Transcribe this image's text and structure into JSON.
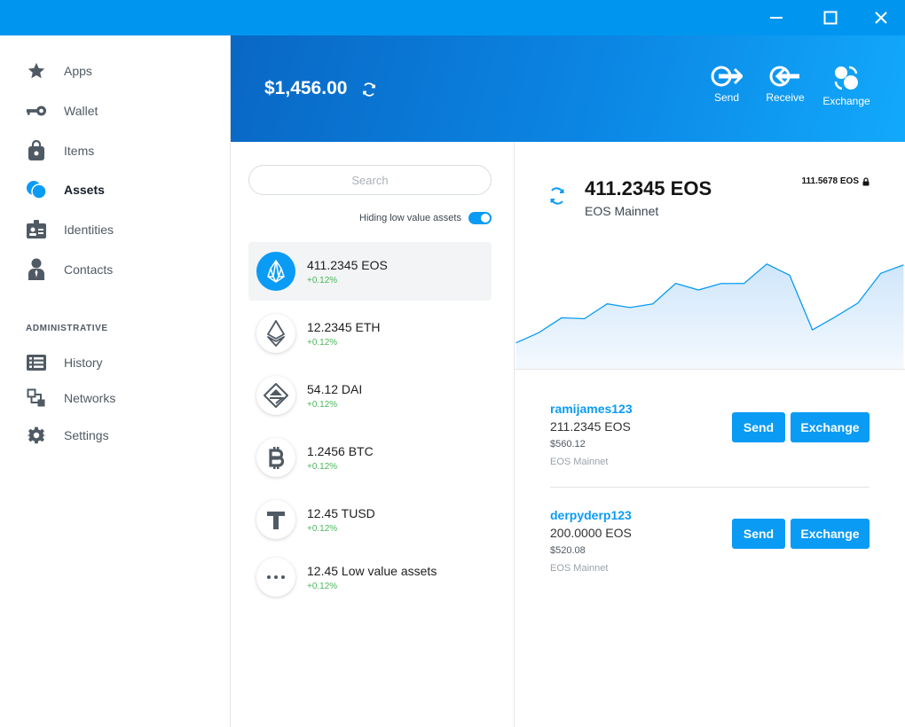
{
  "window": {
    "minimize_icon": "minimize-icon",
    "maximize_icon": "maximize-icon",
    "close_icon": "close-icon"
  },
  "sidebar": {
    "items": [
      {
        "label": "Apps",
        "icon": "star-icon"
      },
      {
        "label": "Wallet",
        "icon": "key-icon"
      },
      {
        "label": "Items",
        "icon": "bag-icon"
      },
      {
        "label": "Assets",
        "icon": "coins-icon",
        "active": true
      },
      {
        "label": "Identities",
        "icon": "id-card-icon"
      },
      {
        "label": "Contacts",
        "icon": "person-icon"
      }
    ],
    "section_title": "ADMINISTRATIVE",
    "admin_items": [
      {
        "label": "History",
        "icon": "list-icon"
      },
      {
        "label": "Networks",
        "icon": "network-icon"
      },
      {
        "label": "Settings",
        "icon": "gear-icon"
      }
    ]
  },
  "header": {
    "balance": "$1,456.00",
    "actions": [
      {
        "label": "Send",
        "icon": "send-icon"
      },
      {
        "label": "Receive",
        "icon": "receive-icon"
      },
      {
        "label": "Exchange",
        "icon": "exchange-icon"
      }
    ]
  },
  "asset_list": {
    "search_placeholder": "Search",
    "hide_toggle_label": "Hiding low value assets",
    "hide_toggle_on": true,
    "assets": [
      {
        "name": "411.2345 EOS",
        "change": "+0.12%",
        "icon": "eos-icon",
        "selected": true
      },
      {
        "name": "12.2345 ETH",
        "change": "+0.12%",
        "icon": "eth-icon"
      },
      {
        "name": "54.12 DAI",
        "change": "+0.12%",
        "icon": "dai-icon"
      },
      {
        "name": "1.2456 BTC",
        "change": "+0.12%",
        "icon": "btc-icon"
      },
      {
        "name": "12.45 TUSD",
        "change": "+0.12%",
        "icon": "tusd-icon"
      },
      {
        "name": "12.45 Low value assets",
        "change": "+0.12%",
        "icon": "more-icon"
      }
    ]
  },
  "detail": {
    "amount": "411.2345 EOS",
    "network": "EOS Mainnet",
    "locked_amount": "111.5678 EOS",
    "chart_values": [
      28,
      39,
      55,
      54,
      70,
      66,
      70,
      92,
      85,
      92,
      92,
      113,
      101,
      42,
      56,
      71,
      103,
      112
    ],
    "accounts": [
      {
        "name": "ramijames123",
        "balance": "211.2345 EOS",
        "usd": "$560.12",
        "network": "EOS Mainnet",
        "send_label": "Send",
        "exchange_label": "Exchange"
      },
      {
        "name": "derpyderp123",
        "balance": "200.0000 EOS",
        "usd": "$520.08",
        "network": "EOS Mainnet",
        "send_label": "Send",
        "exchange_label": "Exchange"
      }
    ]
  },
  "colors": {
    "accent": "#0a9bf5",
    "titlebar": "#0096f0",
    "positive": "#49b85a"
  }
}
